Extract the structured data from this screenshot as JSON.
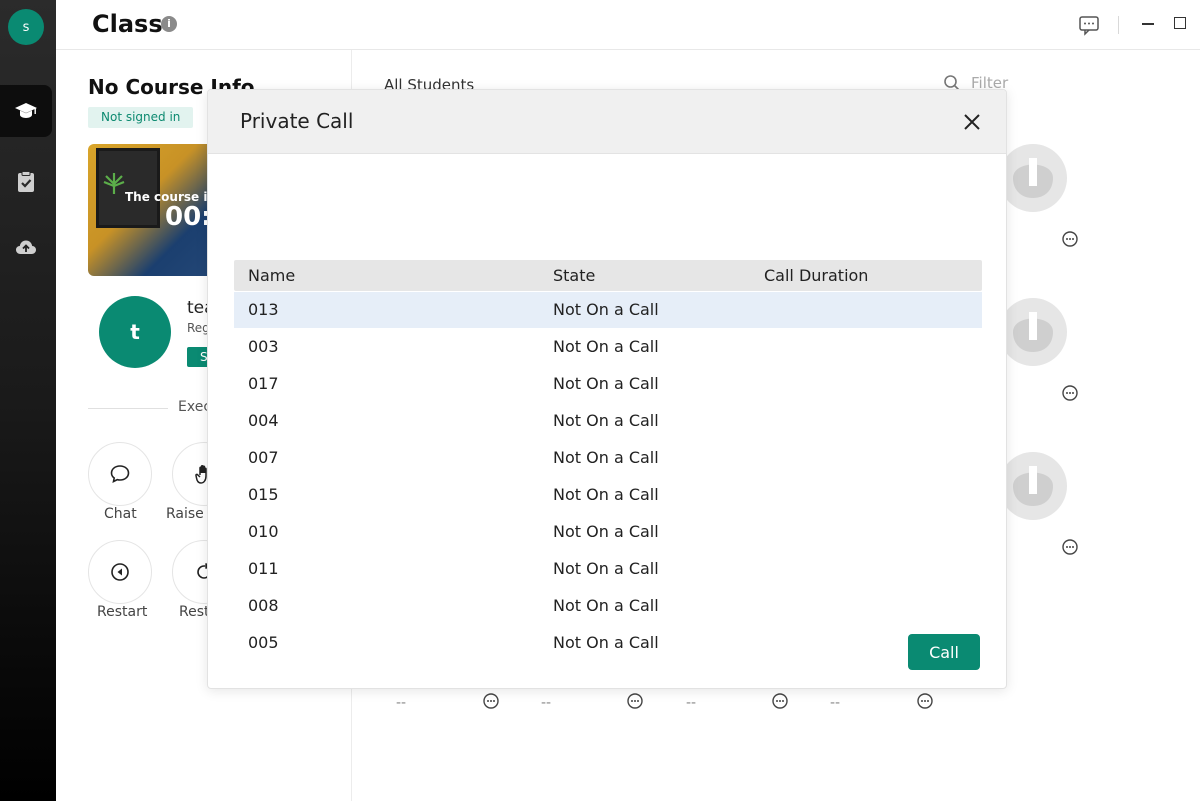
{
  "user": {
    "initial": "s"
  },
  "header": {
    "title": "Class",
    "info_glyph": "i"
  },
  "course": {
    "title": "No Course Info",
    "sign_status": "Not signed in",
    "card_caption": "The course is",
    "card_timer": "00:"
  },
  "teacher": {
    "initial": "t",
    "name": "tea",
    "role": "Reg",
    "status": "S"
  },
  "execution_label": "Exec",
  "actions": [
    {
      "label": "Chat",
      "icon": "chat-icon"
    },
    {
      "label": "Raise I",
      "icon": "hand-icon"
    },
    {
      "label": "Restart",
      "icon": "restart-icon"
    },
    {
      "label": "Rest",
      "icon": "reset-icon"
    }
  ],
  "students_panel": {
    "heading": "All Students",
    "filter_placeholder": "Filter",
    "placeholders": [
      "--",
      "--",
      "--",
      "--"
    ]
  },
  "modal": {
    "title": "Private Call",
    "columns": [
      "Name",
      "State",
      "Call Duration"
    ],
    "rows": [
      {
        "name": "013",
        "state": "Not On a Call",
        "duration": ""
      },
      {
        "name": "003",
        "state": "Not On a Call",
        "duration": ""
      },
      {
        "name": "017",
        "state": "Not On a Call",
        "duration": ""
      },
      {
        "name": "004",
        "state": "Not On a Call",
        "duration": ""
      },
      {
        "name": "007",
        "state": "Not On a Call",
        "duration": ""
      },
      {
        "name": "015",
        "state": "Not On a Call",
        "duration": ""
      },
      {
        "name": "010",
        "state": "Not On a Call",
        "duration": ""
      },
      {
        "name": "011",
        "state": "Not On a Call",
        "duration": ""
      },
      {
        "name": "008",
        "state": "Not On a Call",
        "duration": ""
      },
      {
        "name": "005",
        "state": "Not On a Call",
        "duration": ""
      }
    ],
    "call_button": "Call"
  },
  "colors": {
    "accent": "#0a8a72",
    "selected_row": "#e6eef8",
    "badge_bg": "#e2f3ef"
  }
}
